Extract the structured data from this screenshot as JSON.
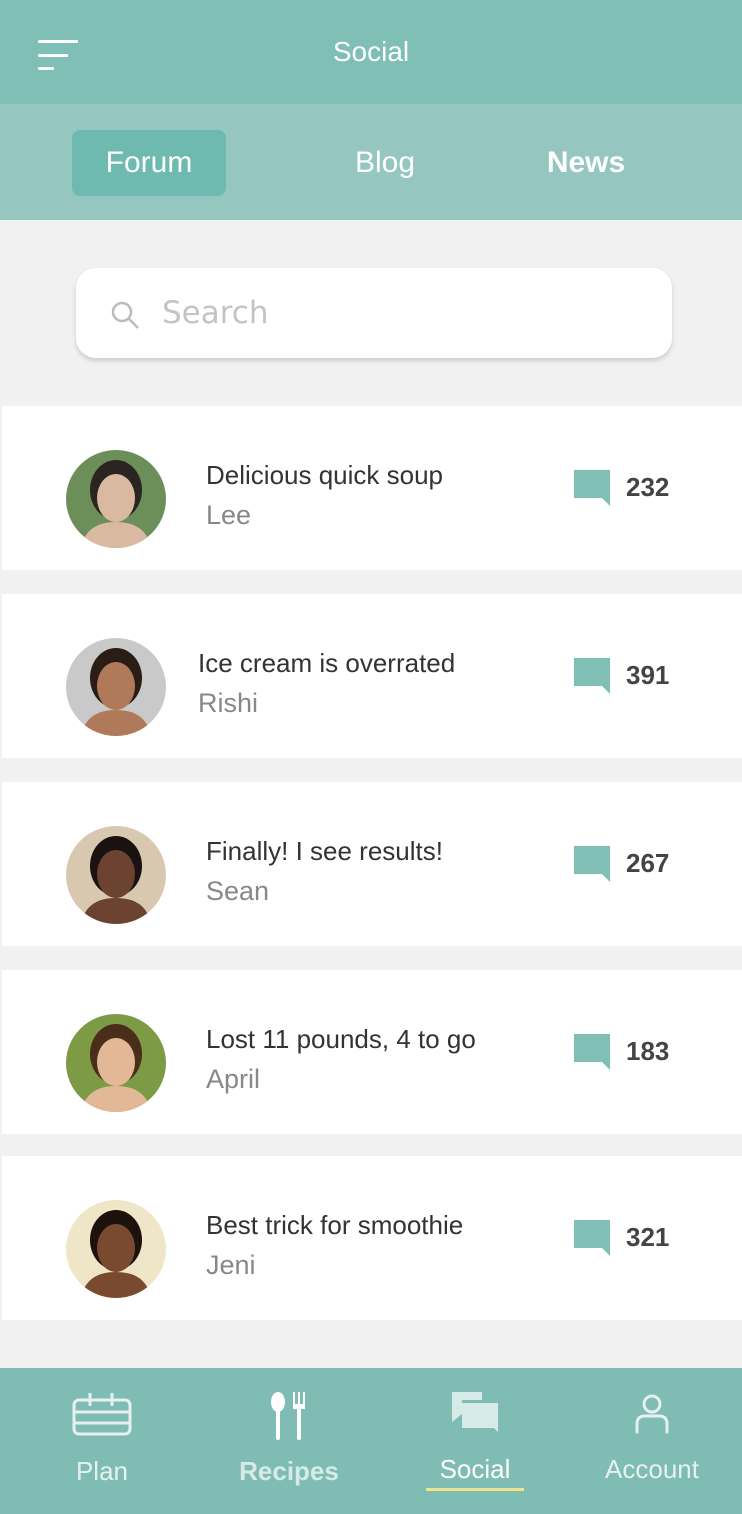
{
  "header": {
    "title": "Social"
  },
  "tabs": [
    {
      "label": "Forum",
      "active": true
    },
    {
      "label": "Blog"
    },
    {
      "label": "News"
    }
  ],
  "search": {
    "placeholder": "Search",
    "value": ""
  },
  "posts": [
    {
      "title": "Delicious quick soup",
      "author": "Lee",
      "comments": "232"
    },
    {
      "title": "Ice cream is overrated",
      "author": "Rishi",
      "comments": "391"
    },
    {
      "title": "Finally! I see results!",
      "author": "Sean",
      "comments": "267"
    },
    {
      "title": "Lost 11 pounds, 4 to go",
      "author": "April",
      "comments": "183"
    },
    {
      "title": "Best trick for smoothie",
      "author": "Jeni",
      "comments": "321"
    }
  ],
  "nav": [
    {
      "label": "Plan",
      "icon": "calendar-icon"
    },
    {
      "label": "Recipes",
      "icon": "cutlery-icon"
    },
    {
      "label": "Social",
      "icon": "chat-icon",
      "active": true
    },
    {
      "label": "Account",
      "icon": "person-icon"
    }
  ],
  "colors": {
    "primary": "#7fbfb6",
    "tabbar": "#95c6bf",
    "active_tab": "#6fbab0",
    "underline": "#efe48a"
  }
}
